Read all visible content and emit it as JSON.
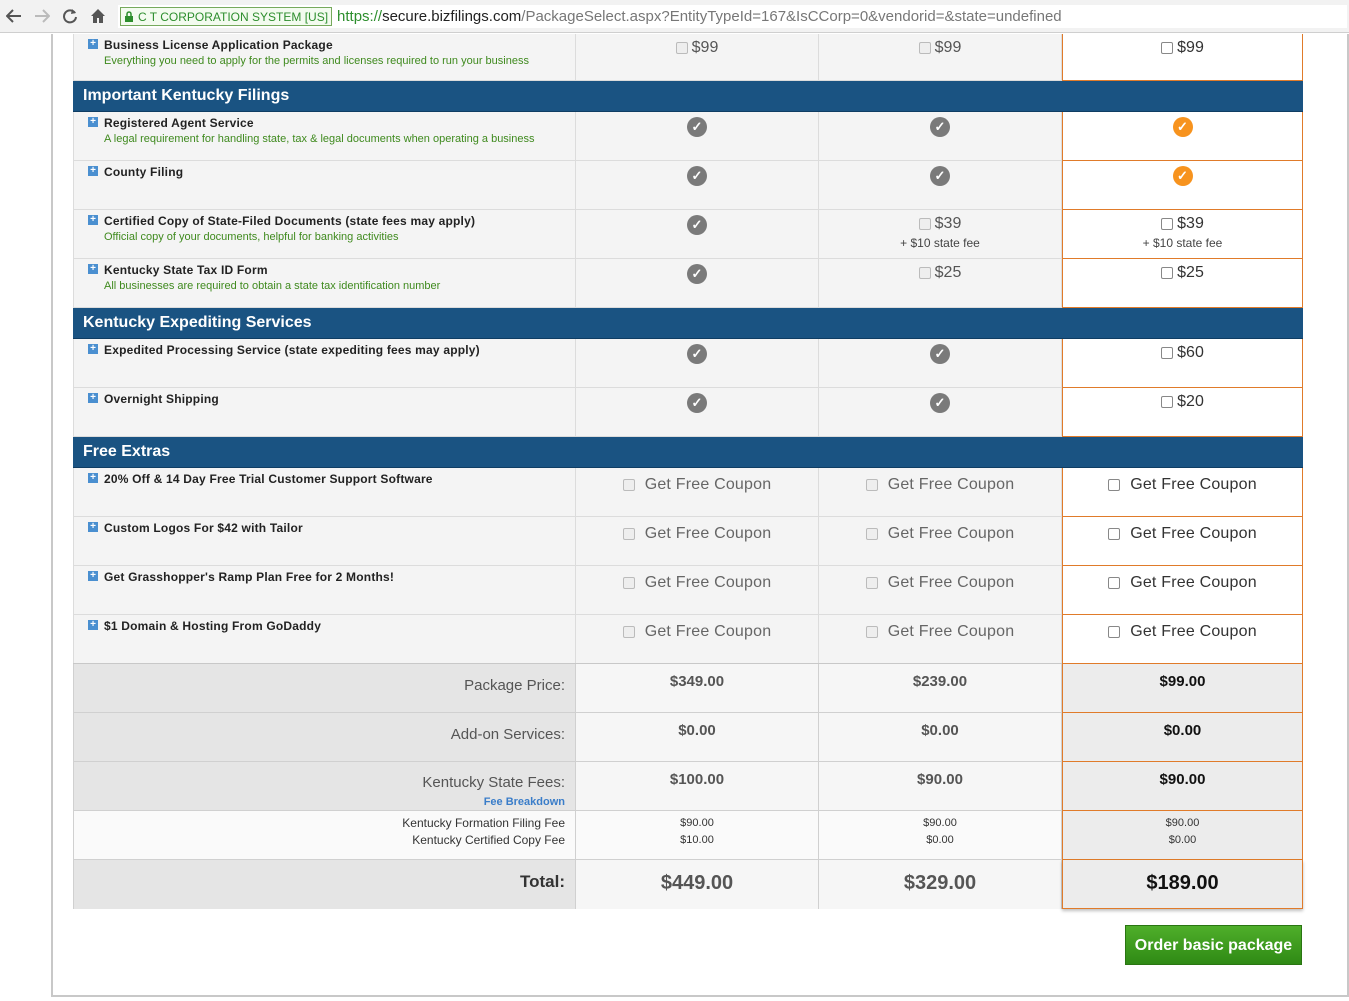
{
  "browser": {
    "ssl_label": "C T CORPORATION SYSTEM [US]",
    "url_scheme": "https://",
    "url_domain": "secure.bizfilings.com",
    "url_path": "/PackageSelect.aspx?EntityTypeId=167&IsCCorp=0&vendorid=&state=undefined"
  },
  "top_row": {
    "name": "Business License Application Package",
    "desc": "Everything you need to apply for the permits and licenses required to run your business",
    "col1": "$99",
    "col2": "$99",
    "col3": "$99"
  },
  "sections": {
    "filings": "Important Kentucky Filings",
    "expediting": "Kentucky Expediting Services",
    "extras": "Free Extras"
  },
  "filings": [
    {
      "name": "Registered Agent Service",
      "desc": "A legal requirement for handling state, tax & legal documents when operating a business"
    },
    {
      "name": "County Filing",
      "desc": ""
    },
    {
      "name": "Certified Copy of State-Filed Documents (state fees may apply)",
      "desc": "Official copy of your documents, helpful for banking activities",
      "col2": "$39",
      "col2_sub": "+ $10 state fee",
      "col3": "$39",
      "col3_sub": "+ $10 state fee"
    },
    {
      "name": "Kentucky State Tax ID Form",
      "desc": "All businesses are required to obtain a state tax identification number",
      "col2": "$25",
      "col3": "$25"
    }
  ],
  "expediting": [
    {
      "name": "Expedited Processing Service (state expediting fees may apply)",
      "col3": "$60"
    },
    {
      "name": "Overnight Shipping",
      "col3": "$20"
    }
  ],
  "extras": [
    {
      "name": "20% Off & 14 Day Free Trial Customer Support Software"
    },
    {
      "name": "Custom Logos For $42 with Tailor"
    },
    {
      "name": "Get Grasshopper's Ramp Plan Free for 2 Months!"
    },
    {
      "name": "$1 Domain & Hosting From GoDaddy"
    }
  ],
  "coupon_label": "Get Free Coupon",
  "summary": {
    "package_label": "Package Price:",
    "package": [
      "$349.00",
      "$239.00",
      "$99.00"
    ],
    "addon_label": "Add-on Services:",
    "addon": [
      "$0.00",
      "$0.00",
      "$0.00"
    ],
    "state_label": "Kentucky State Fees:",
    "fee_breakdown": "Fee Breakdown",
    "state": [
      "$100.00",
      "$90.00",
      "$90.00"
    ],
    "formation_label": "Kentucky Formation Filing Fee",
    "certified_label": "Kentucky Certified Copy Fee",
    "formation": [
      "$90.00",
      "$90.00",
      "$90.00"
    ],
    "certified": [
      "$10.00",
      "$0.00",
      "$0.00"
    ],
    "total_label": "Total:",
    "total": [
      "$449.00",
      "$329.00",
      "$189.00"
    ]
  },
  "order_button": "Order basic package",
  "colors": {
    "section_bg": "#1a5382",
    "selected_border": "#e07b2a",
    "check_orange": "#f7931e",
    "button_green": "#3c9a1f"
  }
}
